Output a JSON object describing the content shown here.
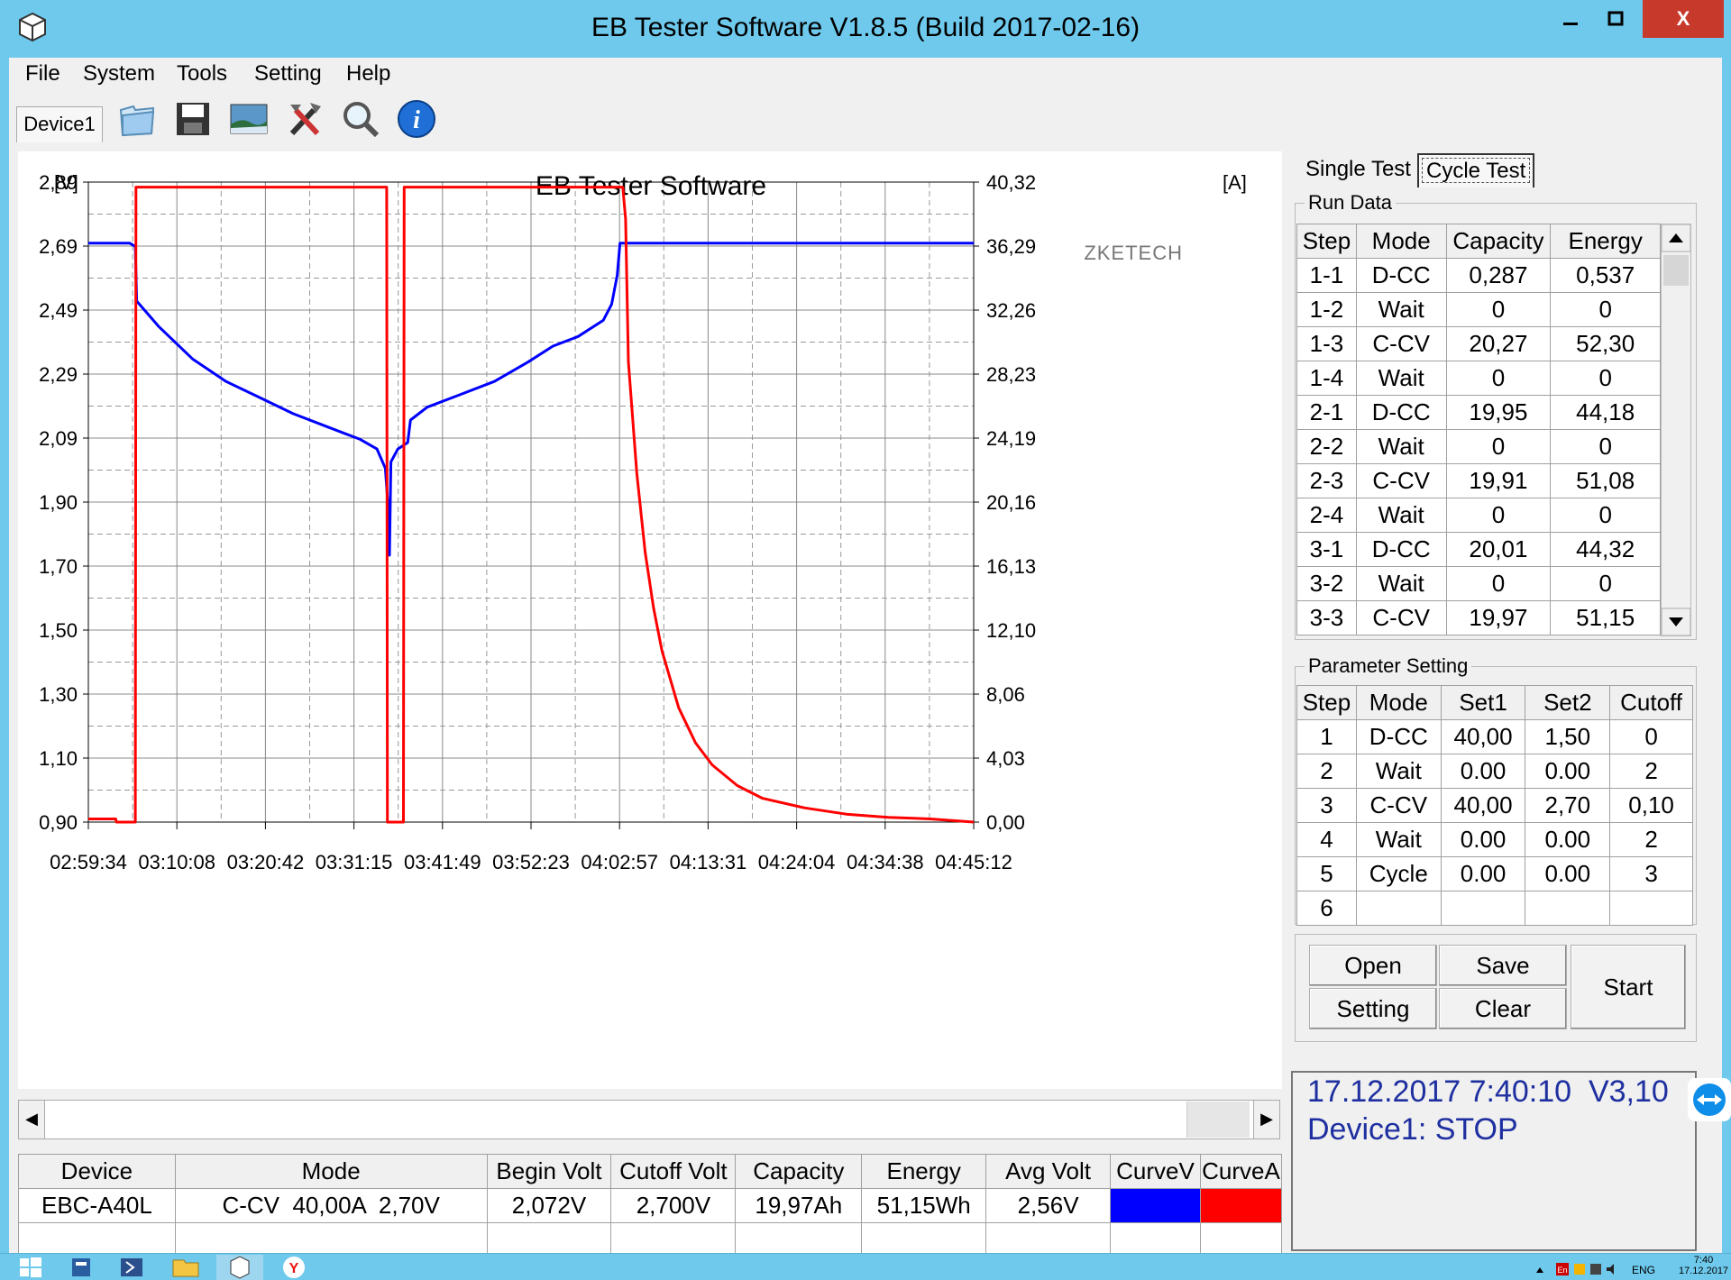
{
  "window": {
    "title": "EB Tester Software V1.8.5 (Build 2017-02-16)",
    "min": "▁",
    "max": "☐",
    "close": "X"
  },
  "menu": [
    "File",
    "System",
    "Tools",
    "Setting",
    "Help"
  ],
  "device_tab": "Device1",
  "toolbar_icons": [
    "folder-icon",
    "save-icon",
    "image-icon",
    "tools-icon",
    "search-icon",
    "info-icon"
  ],
  "chart": {
    "title": "EB Tester Software",
    "left_unit": "[V]",
    "right_unit": "[A]",
    "watermark": "ZKETECH"
  },
  "chart_data": {
    "type": "line",
    "title": "EB Tester Software",
    "ylabel": "[V]",
    "y2label": "[A]",
    "ylim": [
      0.9,
      2.89
    ],
    "y2lim": [
      0,
      40.32
    ],
    "xlim": [
      "02:59:34",
      "04:45:12"
    ],
    "x_tick_labels": [
      "02:59:34",
      "03:10:08",
      "03:20:42",
      "03:31:15",
      "03:41:49",
      "03:52:23",
      "04:02:57",
      "04:13:31",
      "04:24:04",
      "04:34:38",
      "04:45:12"
    ],
    "y_tick_labels": [
      "2,89",
      "2,69",
      "2,49",
      "2,29",
      "2,09",
      "1,90",
      "1,70",
      "1,50",
      "1,30",
      "1,10",
      "0,90"
    ],
    "y2_tick_labels": [
      "40,32",
      "36,29",
      "32,26",
      "28,23",
      "24,19",
      "20,16",
      "16,13",
      "12,10",
      "8,06",
      "4,03",
      "0,00"
    ],
    "grid": true,
    "series": [
      {
        "name": "CurveV",
        "axis": "left",
        "color": "#0000ff",
        "points": [
          [
            "02:59:34",
            2.7
          ],
          [
            "03:04:30",
            2.7
          ],
          [
            "03:05:10",
            2.69
          ],
          [
            "03:05:20",
            2.52
          ],
          [
            "03:08:00",
            2.44
          ],
          [
            "03:12:00",
            2.34
          ],
          [
            "03:16:00",
            2.27
          ],
          [
            "03:20:00",
            2.22
          ],
          [
            "03:24:00",
            2.17
          ],
          [
            "03:28:00",
            2.13
          ],
          [
            "03:32:00",
            2.09
          ],
          [
            "03:34:00",
            2.06
          ],
          [
            "03:35:00",
            2.0
          ],
          [
            "03:35:20",
            1.88
          ],
          [
            "03:35:30",
            1.73
          ],
          [
            "03:35:40",
            2.02
          ],
          [
            "03:36:30",
            2.06
          ],
          [
            "03:37:40",
            2.08
          ],
          [
            "03:38:00",
            2.15
          ],
          [
            "03:40:00",
            2.19
          ],
          [
            "03:44:00",
            2.23
          ],
          [
            "03:48:00",
            2.27
          ],
          [
            "03:52:00",
            2.33
          ],
          [
            "03:55:00",
            2.38
          ],
          [
            "03:58:00",
            2.41
          ],
          [
            "04:01:00",
            2.46
          ],
          [
            "04:02:00",
            2.51
          ],
          [
            "04:02:40",
            2.6
          ],
          [
            "04:03:00",
            2.7
          ],
          [
            "04:45:12",
            2.7
          ]
        ]
      },
      {
        "name": "CurveA",
        "axis": "right",
        "color": "#ff0000",
        "points": [
          [
            "02:59:34",
            0.2
          ],
          [
            "03:02:50",
            0.2
          ],
          [
            "03:02:55",
            0.0
          ],
          [
            "03:05:10",
            0.0
          ],
          [
            "03:05:15",
            40.0
          ],
          [
            "03:35:10",
            40.0
          ],
          [
            "03:35:15",
            0.0
          ],
          [
            "03:37:10",
            0.0
          ],
          [
            "03:37:15",
            40.0
          ],
          [
            "04:03:20",
            40.0
          ],
          [
            "04:03:40",
            38.0
          ],
          [
            "04:04:00",
            29.0
          ],
          [
            "04:05:00",
            22.0
          ],
          [
            "04:06:00",
            17.0
          ],
          [
            "04:07:00",
            13.5
          ],
          [
            "04:08:00",
            10.8
          ],
          [
            "04:10:00",
            7.2
          ],
          [
            "04:12:00",
            5.0
          ],
          [
            "04:14:00",
            3.6
          ],
          [
            "04:17:00",
            2.3
          ],
          [
            "04:20:00",
            1.5
          ],
          [
            "04:25:00",
            0.9
          ],
          [
            "04:30:00",
            0.5
          ],
          [
            "04:35:00",
            0.3
          ],
          [
            "04:40:00",
            0.2
          ],
          [
            "04:45:12",
            0.0
          ]
        ]
      }
    ]
  },
  "tabs": {
    "single": "Single Test",
    "cycle": "Cycle Test"
  },
  "run_data": {
    "legend": "Run Data",
    "headers": [
      "Step",
      "Mode",
      "Capacity",
      "Energy"
    ],
    "rows": [
      [
        "1-1",
        "D-CC",
        "0,287",
        "0,537"
      ],
      [
        "1-2",
        "Wait",
        "0",
        "0"
      ],
      [
        "1-3",
        "C-CV",
        "20,27",
        "52,30"
      ],
      [
        "1-4",
        "Wait",
        "0",
        "0"
      ],
      [
        "2-1",
        "D-CC",
        "19,95",
        "44,18"
      ],
      [
        "2-2",
        "Wait",
        "0",
        "0"
      ],
      [
        "2-3",
        "C-CV",
        "19,91",
        "51,08"
      ],
      [
        "2-4",
        "Wait",
        "0",
        "0"
      ],
      [
        "3-1",
        "D-CC",
        "20,01",
        "44,32"
      ],
      [
        "3-2",
        "Wait",
        "0",
        "0"
      ],
      [
        "3-3",
        "C-CV",
        "19,97",
        "51,15"
      ]
    ]
  },
  "param": {
    "legend": "Parameter Setting",
    "headers": [
      "Step",
      "Mode",
      "Set1",
      "Set2",
      "Cutoff"
    ],
    "rows": [
      [
        "1",
        "D-CC",
        "40,00",
        "1,50",
        "0"
      ],
      [
        "2",
        "Wait",
        "0.00",
        "0.00",
        "2"
      ],
      [
        "3",
        "C-CV",
        "40,00",
        "2,70",
        "0,10"
      ],
      [
        "4",
        "Wait",
        "0.00",
        "0.00",
        "2"
      ],
      [
        "5",
        "Cycle",
        "0.00",
        "0.00",
        "3"
      ],
      [
        "6",
        "",
        "",
        "",
        ""
      ]
    ]
  },
  "buttons": {
    "open": "Open",
    "save": "Save",
    "setting": "Setting",
    "clear": "Clear",
    "start": "Start"
  },
  "status": {
    "line1": "17.12.2017 7:40:10  V3,10",
    "line2": "Device1: STOP"
  },
  "bottom_table": {
    "headers": [
      "Device",
      "Mode",
      "Begin Volt",
      "Cutoff Volt",
      "Capacity",
      "Energy",
      "Avg Volt",
      "CurveV",
      "CurveA"
    ],
    "row": [
      "EBC-A40L",
      "C-CV  40,00A  2,70V",
      "2,072V",
      "2,700V",
      "19,97Ah",
      "51,15Wh",
      "2,56V"
    ],
    "curve_colors": [
      "#0000ff",
      "#ff0000"
    ]
  },
  "taskbar": {
    "tray_lang": "ENG",
    "tray_time": "7:40",
    "tray_date": "17.12.2017"
  }
}
